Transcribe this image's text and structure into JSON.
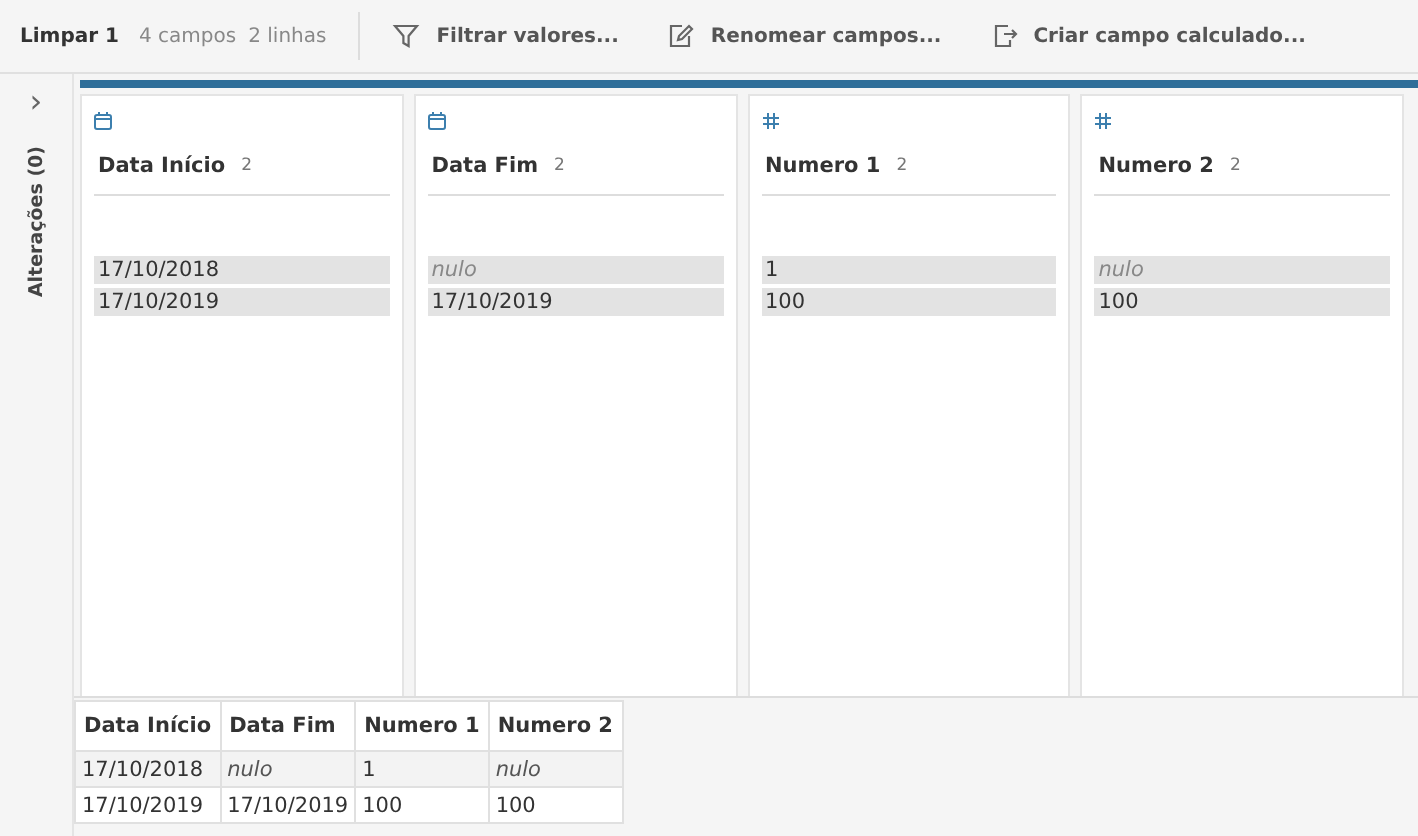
{
  "toolbar": {
    "title": "Limpar 1",
    "field_count": "4 campos",
    "row_count": "2 linhas",
    "actions": [
      {
        "kind": "filter",
        "label": "Filtrar valores..."
      },
      {
        "kind": "rename",
        "label": "Renomear campos..."
      },
      {
        "kind": "calc",
        "label": "Criar campo calculado..."
      }
    ]
  },
  "sidebar": {
    "expand_glyph": "›",
    "label": "Alterações (0)"
  },
  "profile_cards": [
    {
      "kind": "date",
      "name": "Data Início",
      "count": "2",
      "values": [
        {
          "text": "17/10/2018",
          "null": false
        },
        {
          "text": "17/10/2019",
          "null": false
        }
      ]
    },
    {
      "kind": "date",
      "name": "Data Fim",
      "count": "2",
      "values": [
        {
          "text": "nulo",
          "null": true
        },
        {
          "text": "17/10/2019",
          "null": false
        }
      ]
    },
    {
      "kind": "number",
      "name": "Numero 1",
      "count": "2",
      "values": [
        {
          "text": "1",
          "null": false
        },
        {
          "text": "100",
          "null": false
        }
      ]
    },
    {
      "kind": "number",
      "name": "Numero 2",
      "count": "2",
      "values": [
        {
          "text": "nulo",
          "null": true
        },
        {
          "text": "100",
          "null": false
        }
      ]
    }
  ],
  "table": {
    "columns": [
      "Data Início",
      "Data Fim",
      "Numero 1",
      "Numero 2"
    ],
    "rows": [
      [
        {
          "text": "17/10/2018",
          "null": false
        },
        {
          "text": "nulo",
          "null": true
        },
        {
          "text": "1",
          "null": false
        },
        {
          "text": "nulo",
          "null": true
        }
      ],
      [
        {
          "text": "17/10/2019",
          "null": false
        },
        {
          "text": "17/10/2019",
          "null": false
        },
        {
          "text": "100",
          "null": false
        },
        {
          "text": "100",
          "null": false
        }
      ]
    ]
  }
}
